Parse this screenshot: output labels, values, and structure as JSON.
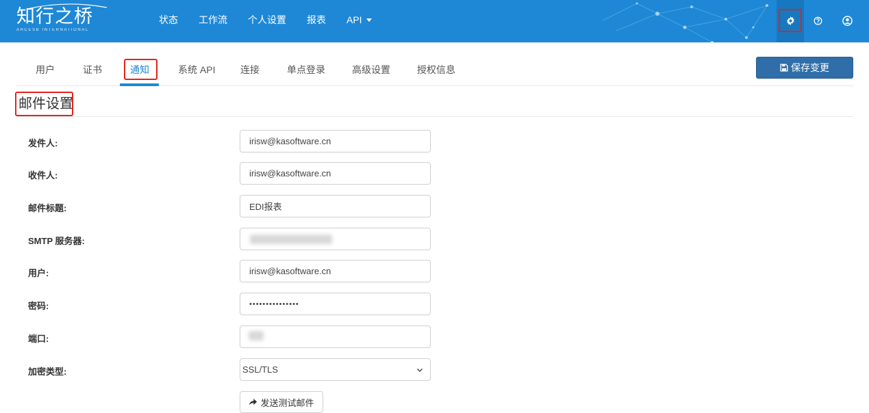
{
  "brand": {
    "name": "知行之桥",
    "tagline": "ARCESB INTERNATIONAL"
  },
  "topnav": {
    "items": [
      "状态",
      "工作流",
      "个人设置",
      "报表"
    ],
    "api_label": "API"
  },
  "top_icons": [
    "gear-icon",
    "help-icon",
    "user-icon"
  ],
  "tabs": [
    "用户",
    "证书",
    "通知",
    "系统 API",
    "连接",
    "单点登录",
    "高级设置",
    "授权信息"
  ],
  "active_tab": "通知",
  "save_button": "保存变更",
  "section_title": "邮件设置",
  "form": {
    "from_label": "发件人:",
    "from_value": "irisw@kasoftware.cn",
    "to_label": "收件人:",
    "to_value": "irisw@kasoftware.cn",
    "subject_label": "邮件标题:",
    "subject_value": "EDI报表",
    "smtp_label": "SMTP 服务器:",
    "user_label": "用户:",
    "user_value": "irisw@kasoftware.cn",
    "password_label": "密码:",
    "password_value": "•••••••••••••••",
    "port_label": "端口:",
    "encryption_label": "加密类型:",
    "encryption_value": "SSL/TLS"
  },
  "test_button": "发送测试邮件",
  "colors": {
    "header": "#1e88d6",
    "accent": "#1e88d6",
    "save_button": "#2f6ea8",
    "highlight": "#e2231a"
  }
}
